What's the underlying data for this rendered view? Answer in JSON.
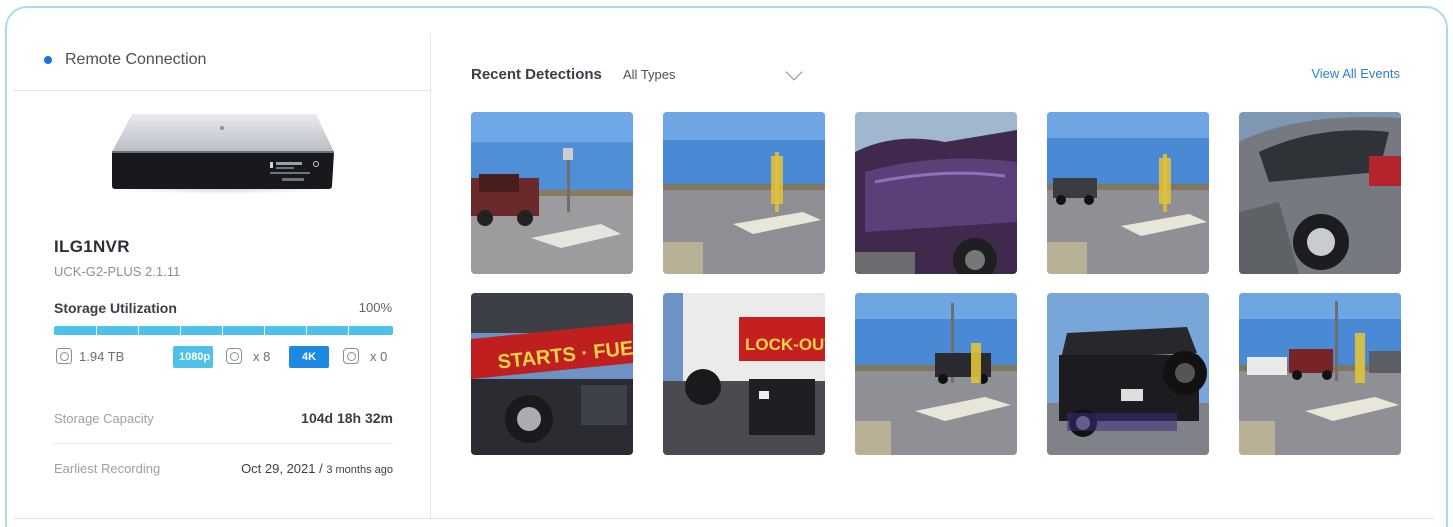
{
  "remote": {
    "label": "Remote Connection",
    "status_color": "#1b6ee6"
  },
  "device": {
    "name": "ILG1NVR",
    "model": "UCK-G2-PLUS 2.1.11",
    "storage_label": "Storage Utilization",
    "storage_pct": "100%",
    "storage_fraction": 1.0,
    "bar_color": "#4fc1e9",
    "disk_size": "1.94 TB",
    "badge_1080": "1080p",
    "count_1080": "x 8",
    "badge_4k": "4K",
    "count_4k": "x 0"
  },
  "info": {
    "capacity_label": "Storage Capacity",
    "capacity_value": "104d 18h 32m",
    "earliest_label": "Earliest Recording",
    "earliest_date": "Oct 29, 2021 / ",
    "earliest_ago": "3 months ago"
  },
  "detections": {
    "title": "Recent Detections",
    "filter": "All Types",
    "view_all": "View All Events",
    "thumbnails": [
      {
        "scene": "parking-pickup-truck"
      },
      {
        "scene": "parking-lot-pole"
      },
      {
        "scene": "car-closeup-purple"
      },
      {
        "scene": "parking-lot-car-far"
      },
      {
        "scene": "silver-suv-closeup"
      },
      {
        "scene": "tow-truck-fuel-sign",
        "text": "STARTS · FUE"
      },
      {
        "scene": "tow-truck-lockouts",
        "text": "LOCK-OUTS"
      },
      {
        "scene": "parking-lot-black-car"
      },
      {
        "scene": "black-jeep-rear"
      },
      {
        "scene": "parking-lot-red-truck"
      }
    ]
  },
  "colors": {
    "accent": "#4fc1e9",
    "link": "#2f7fd1",
    "badge_1080": "#4fc1e9",
    "badge_4k": "#1e88e5",
    "frame_border": "#a8dcec"
  }
}
